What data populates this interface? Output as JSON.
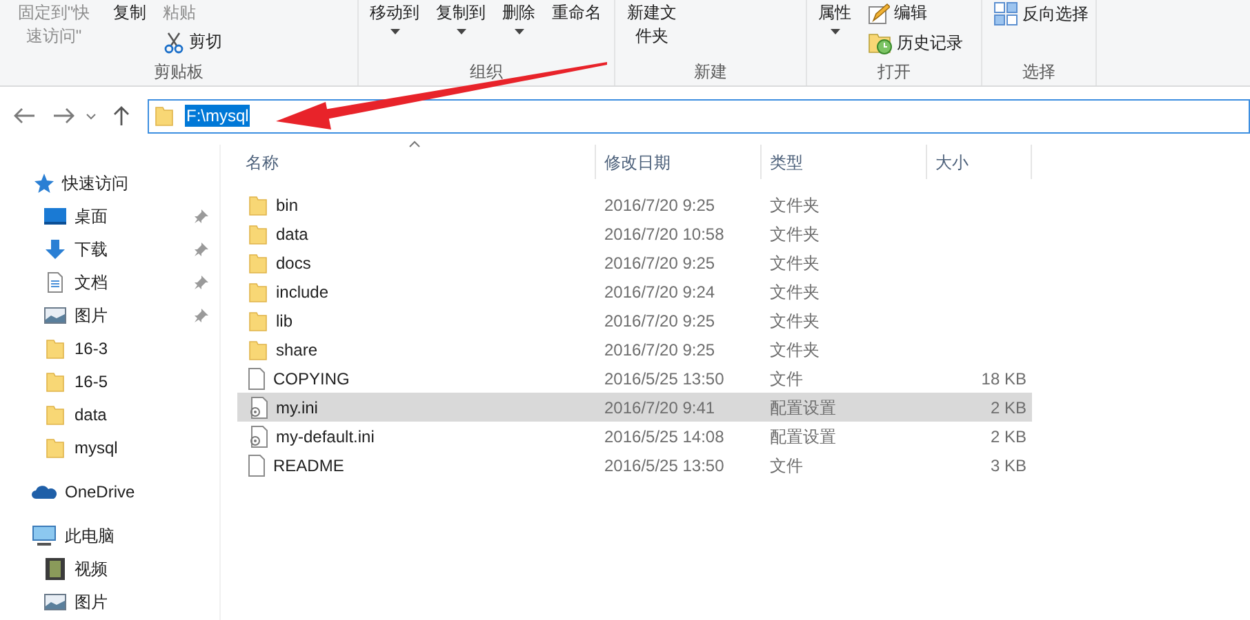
{
  "ribbon": {
    "groups": [
      {
        "label": "剪贴板",
        "columns": [
          [
            {
              "label": "固定到\"快速访问\"",
              "kind": "large",
              "disabled": true,
              "dropdown": false
            }
          ],
          [
            {
              "label": "复制",
              "kind": "large",
              "disabled": false,
              "dropdown": false
            }
          ],
          [
            {
              "label": "粘贴",
              "kind": "large",
              "disabled": true,
              "dropdown": false
            },
            {
              "label": "剪切",
              "kind": "small",
              "disabled": false,
              "dropdown": false
            }
          ]
        ]
      },
      {
        "label": "组织",
        "columns": [
          [
            {
              "label": "移动到",
              "kind": "large",
              "disabled": false,
              "dropdown": true
            }
          ],
          [
            {
              "label": "复制到",
              "kind": "large",
              "disabled": false,
              "dropdown": true
            }
          ],
          [
            {
              "label": "删除",
              "kind": "large",
              "disabled": false,
              "dropdown": true
            }
          ],
          [
            {
              "label": "重命名",
              "kind": "large",
              "disabled": false,
              "dropdown": false
            }
          ]
        ]
      },
      {
        "label": "新建",
        "columns": [
          [
            {
              "label": "新建文件夹",
              "kind": "large",
              "disabled": false,
              "dropdown": false
            }
          ]
        ]
      },
      {
        "label": "打开",
        "columns": [
          [
            {
              "label": "属性",
              "kind": "large",
              "disabled": false,
              "dropdown": true
            }
          ],
          [
            {
              "label": "编辑",
              "kind": "small",
              "disabled": false,
              "dropdown": false
            },
            {
              "label": "历史记录",
              "kind": "small",
              "disabled": false,
              "dropdown": false
            }
          ]
        ]
      },
      {
        "label": "选择",
        "columns": [
          [
            {
              "label": "反向选择",
              "kind": "small",
              "disabled": false,
              "dropdown": false
            }
          ]
        ]
      }
    ]
  },
  "address": {
    "path": "F:\\mysql",
    "selected": true
  },
  "sidebar": {
    "items": [
      {
        "label": "快速访问",
        "children": [
          {
            "label": "桌面",
            "pinned": true
          },
          {
            "label": "下载",
            "pinned": true
          },
          {
            "label": "文档",
            "pinned": true
          },
          {
            "label": "图片",
            "pinned": true
          },
          {
            "label": "16-3",
            "pinned": false
          },
          {
            "label": "16-5",
            "pinned": false
          },
          {
            "label": "data",
            "pinned": false
          },
          {
            "label": "mysql",
            "pinned": false
          }
        ]
      },
      {
        "label": "OneDrive"
      },
      {
        "label": "此电脑",
        "children": [
          {
            "label": "视频",
            "pinned": false
          },
          {
            "label": "图片",
            "pinned": false
          }
        ]
      }
    ]
  },
  "table": {
    "columns": [
      "名称",
      "修改日期",
      "类型",
      "大小"
    ],
    "rows": [
      {
        "name": "bin",
        "date": "2016/7/20 9:25",
        "type": "文件夹",
        "kind": "folder",
        "selected": false
      },
      {
        "name": "data",
        "date": "2016/7/20 10:58",
        "type": "文件夹",
        "kind": "folder",
        "selected": false
      },
      {
        "name": "docs",
        "date": "2016/7/20 9:25",
        "type": "文件夹",
        "kind": "folder",
        "selected": false
      },
      {
        "name": "include",
        "date": "2016/7/20 9:24",
        "type": "文件夹",
        "kind": "folder",
        "selected": false
      },
      {
        "name": "lib",
        "date": "2016/7/20 9:25",
        "type": "文件夹",
        "kind": "folder",
        "selected": false
      },
      {
        "name": "share",
        "date": "2016/7/20 9:25",
        "type": "文件夹",
        "kind": "folder",
        "selected": false
      },
      {
        "name": "COPYING",
        "date": "2016/5/25 13:50",
        "type": "文件",
        "size": "18 KB",
        "kind": "file",
        "selected": false
      },
      {
        "name": "my.ini",
        "date": "2016/7/20 9:41",
        "type": "配置设置",
        "size": "2 KB",
        "kind": "config",
        "selected": true
      },
      {
        "name": "my-default.ini",
        "date": "2016/5/25 14:08",
        "type": "配置设置",
        "size": "2 KB",
        "kind": "config",
        "selected": false
      },
      {
        "name": "README",
        "date": "2016/5/25 13:50",
        "type": "文件",
        "size": "3 KB",
        "kind": "file",
        "selected": false
      }
    ]
  }
}
